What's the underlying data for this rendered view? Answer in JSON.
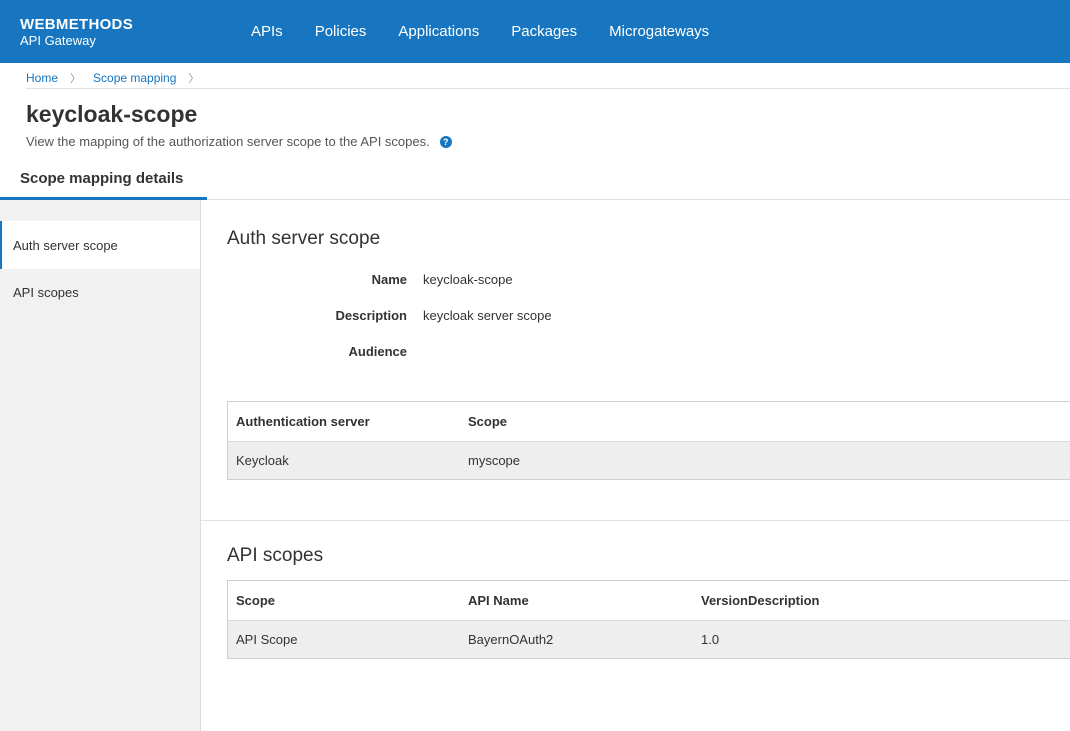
{
  "header": {
    "brand_name": "WEBMETHODS",
    "brand_sub": "API Gateway",
    "nav": [
      "APIs",
      "Policies",
      "Applications",
      "Packages",
      "Microgateways"
    ],
    "background_color": "#1776bf"
  },
  "breadcrumb": [
    "Home",
    "Scope mapping"
  ],
  "page": {
    "title": "keycloak-scope",
    "description": "View the mapping of the authorization server scope to the API scopes.",
    "help_icon": "question-circle-icon"
  },
  "tab": {
    "label": "Scope mapping details"
  },
  "sidebar": {
    "items": [
      "Auth server scope",
      "API scopes"
    ],
    "active_index": 0
  },
  "auth_section": {
    "title": "Auth server scope",
    "fields": [
      {
        "label": "Name",
        "value": "keycloak-scope"
      },
      {
        "label": "Description",
        "value": "keycloak server scope"
      },
      {
        "label": "Audience",
        "value": ""
      }
    ],
    "table": {
      "columns": [
        "Authentication server",
        "Scope"
      ],
      "rows": [
        [
          "Keycloak",
          "myscope"
        ]
      ]
    }
  },
  "api_section": {
    "title": "API scopes",
    "table": {
      "columns": [
        "Scope",
        "API Name",
        "VersionDescription"
      ],
      "rows": [
        [
          "API Scope",
          "BayernOAuth2",
          "1.0"
        ]
      ]
    }
  }
}
